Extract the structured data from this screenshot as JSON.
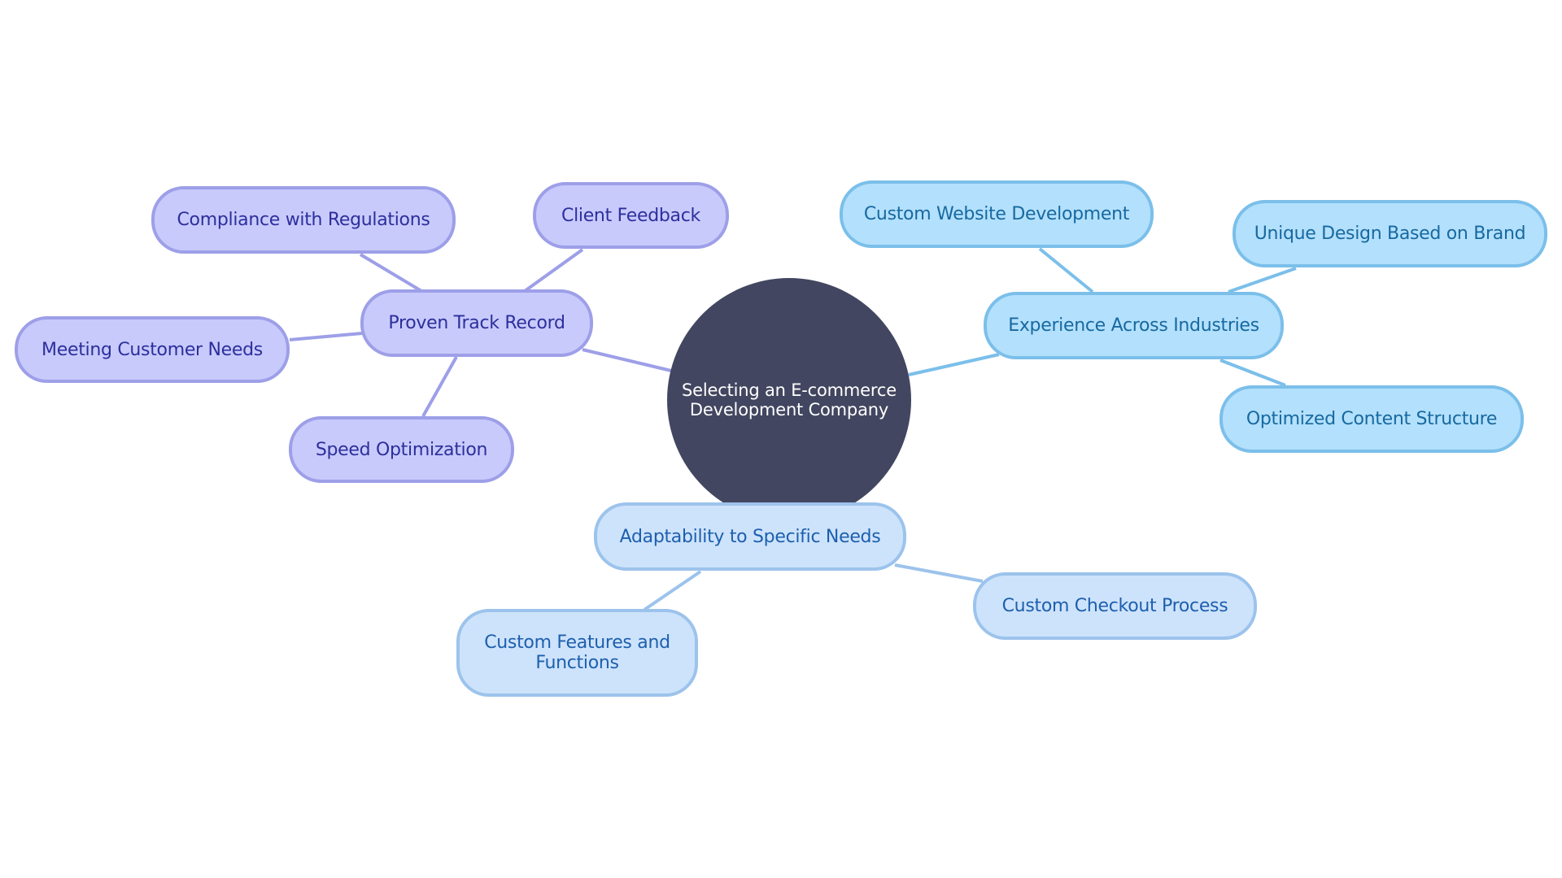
{
  "diagram": {
    "type": "mindmap",
    "colors": {
      "root_fill": "#424660",
      "root_text": "#ffffff",
      "branch_purple": {
        "fill": "#C8CAFC",
        "stroke": "#9D9FE8",
        "text": "#2D2F9C"
      },
      "branch_sky": {
        "fill": "#B3E0FC",
        "stroke": "#7BBFEA",
        "text": "#1769A0"
      },
      "branch_pale": {
        "fill": "#CDE3FB",
        "stroke": "#9CC3EC",
        "text": "#1D5FAE"
      }
    },
    "root": {
      "label_line1": "Selecting an E-commerce",
      "label_line2": "Development Company"
    },
    "branches": [
      {
        "label": "Proven Track Record",
        "children": [
          {
            "label": "Compliance with Regulations"
          },
          {
            "label": "Client Feedback"
          },
          {
            "label": "Meeting Customer Needs"
          },
          {
            "label": "Speed Optimization"
          }
        ]
      },
      {
        "label": "Experience Across Industries",
        "children": [
          {
            "label": "Custom Website Development"
          },
          {
            "label": "Unique Design Based on Brand"
          },
          {
            "label": "Optimized Content Structure"
          }
        ]
      },
      {
        "label": "Adaptability to Specific Needs",
        "children": [
          {
            "label": "Custom Features and Functions"
          },
          {
            "label": "Custom Checkout Process"
          }
        ]
      }
    ]
  }
}
